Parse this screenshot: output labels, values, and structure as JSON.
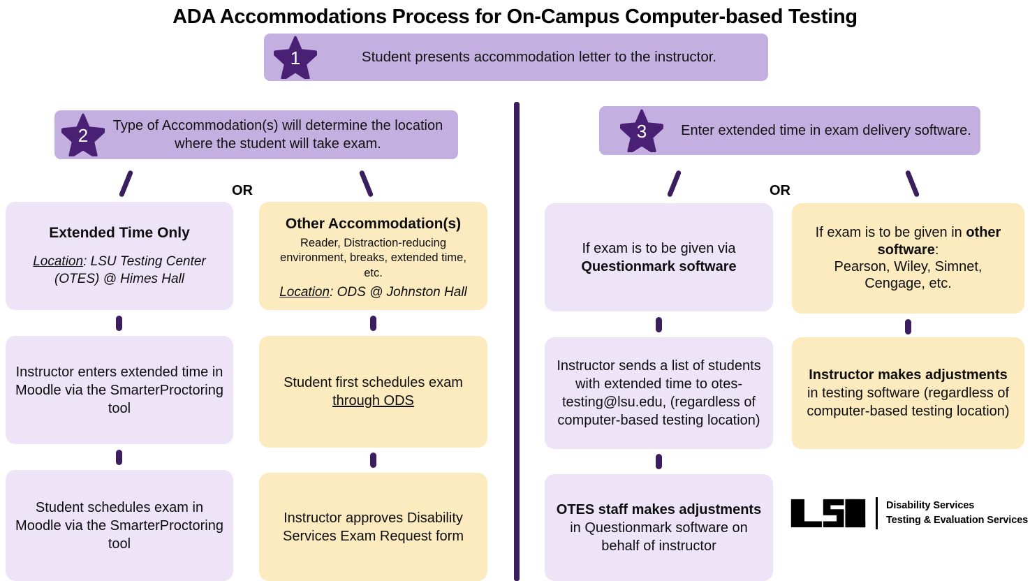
{
  "title": "ADA Accommodations Process for On-Campus Computer-based Testing",
  "colors": {
    "step_bar": "#C4B0E0",
    "lavender_box": "#EDE4F8",
    "yellow_box": "#FCEBBE",
    "purple_accent": "#3B1E5E",
    "text": "#111111"
  },
  "steps": {
    "step1": {
      "number": "1",
      "text": "Student presents accommodation letter to the instructor."
    },
    "step2": {
      "number": "2",
      "text": "Type of Accommodation(s) will determine the location where the student will take exam."
    },
    "step3": {
      "number": "3",
      "text": "Enter extended time in exam delivery software."
    }
  },
  "or_labels": {
    "left": "OR",
    "right": "OR"
  },
  "left_branch": {
    "option_a": {
      "heading": "Extended Time Only",
      "location_label": "Location",
      "location_value": ": LSU Testing Center (OTES) @ Himes Hall",
      "next_1": "Instructor enters extended time in Moodle via the SmarterProctoring tool",
      "next_2": "Student schedules exam in Moodle via the SmarterProctoring tool"
    },
    "option_b": {
      "heading": "Other Accommodation(s)",
      "detail": "Reader, Distraction-reducing environment, breaks, extended time, etc.",
      "location_label": "Location",
      "location_value": ": ODS @ Johnston Hall",
      "next_1_part1": "Student first schedules exam ",
      "next_1_part2": "through ODS",
      "next_2": "Instructor approves Disability Services Exam Request form"
    }
  },
  "right_branch": {
    "option_a": {
      "line1": "If exam is to be given via ",
      "line2_bold": "Questionmark software",
      "next_1": "Instructor sends a list of students with extended time to otes-testing@lsu.edu, (regardless of computer-based testing location)",
      "next_2_bold": "OTES staff makes adjustments",
      "next_2_rest": " in Questionmark software on behalf of instructor"
    },
    "option_b": {
      "line1": "If exam is to be given in ",
      "line2_bold": "other software",
      "line2_rest": ":",
      "line3": "Pearson, Wiley, Simnet, Cengage, etc.",
      "next_1_bold": "Instructor makes adjustments",
      "next_1_rest": " in testing software (regardless of computer-based testing location)"
    }
  },
  "logo": {
    "mark": "LSU",
    "line1": "Disability Services",
    "line2": "Testing & Evaluation Services"
  }
}
